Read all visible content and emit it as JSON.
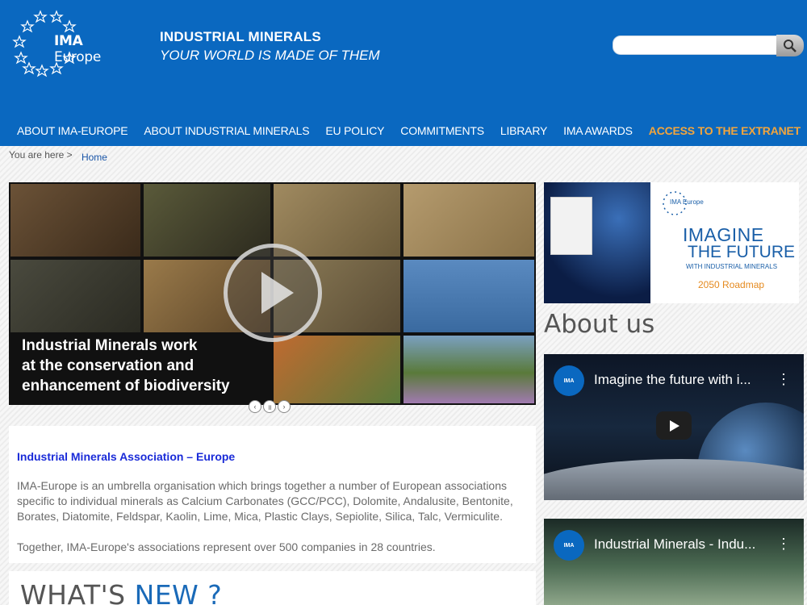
{
  "header": {
    "logo_bold": "IMA",
    "logo_rest": " Europe",
    "tagline_1": "INDUSTRIAL MINERALS",
    "tagline_2": "YOUR WORLD IS MADE OF THEM",
    "search_placeholder": ""
  },
  "nav": {
    "items": [
      "ABOUT IMA-EUROPE",
      "ABOUT INDUSTRIAL MINERALS",
      "EU POLICY",
      "COMMITMENTS",
      "LIBRARY",
      "IMA AWARDS",
      "ACCESS TO THE EXTRANET"
    ]
  },
  "breadcrumb": {
    "prefix": "You are here >",
    "home": "Home"
  },
  "slider": {
    "caption_lines": [
      "Industrial Minerals work",
      "at the conservation and",
      "enhancement of biodiversity"
    ],
    "controls": [
      "prev",
      "pause",
      "next"
    ]
  },
  "intro": {
    "heading": "Industrial Minerals Association – Europe",
    "paragraph_1": "IMA-Europe is an umbrella organisation which brings together a number of European associations specific to individual minerals as Calcium Carbonates (GCC/PCC), Dolomite, Andalusite, Bentonite, Borates, Diatomite, Feldspar, Kaolin, Lime, Mica, Plastic Clays, Sepiolite, Silica, Talc, Vermiculite.",
    "paragraph_2": "Together, IMA-Europe's associations represent over 500 companies in 28 countries."
  },
  "whats_new": {
    "part1": "WHAT'S ",
    "part2": "NEW ?"
  },
  "banner": {
    "logo_text": "IMA Europe",
    "imagine": "IMAGINE",
    "future": "THE FUTURE",
    "sub": "WITH INDUSTRIAL MINERALS",
    "roadmap": "2050 Roadmap"
  },
  "about_us": "About us",
  "videos": [
    {
      "title": "Imagine the future with i...",
      "channel_badge": "IMA"
    },
    {
      "title": "Industrial Minerals - Indu...",
      "channel_badge": "IMA"
    }
  ],
  "colors": {
    "header_blue": "#0a68c0",
    "extranet_orange": "#f3a53c",
    "link_blue": "#1a2bd8",
    "roadmap_orange": "#e58a1f"
  }
}
